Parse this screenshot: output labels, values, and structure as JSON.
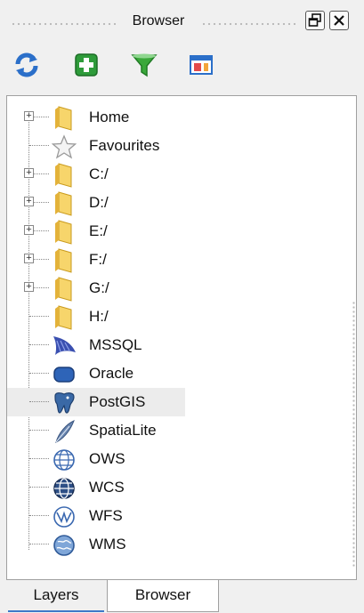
{
  "panel": {
    "title": "Browser"
  },
  "toolbar": {
    "buttons": [
      {
        "name": "refresh",
        "icon": "refresh-icon"
      },
      {
        "name": "add-layer",
        "icon": "add-icon"
      },
      {
        "name": "filter",
        "icon": "filter-icon"
      },
      {
        "name": "collapse-all",
        "icon": "collapse-all-icon"
      }
    ]
  },
  "tree": {
    "items": [
      {
        "label": "Home",
        "icon": "folder-icon",
        "expandable": true
      },
      {
        "label": "Favourites",
        "icon": "star-icon",
        "expandable": false
      },
      {
        "label": "C:/",
        "icon": "folder-icon",
        "expandable": true
      },
      {
        "label": "D:/",
        "icon": "folder-icon",
        "expandable": true
      },
      {
        "label": "E:/",
        "icon": "folder-icon",
        "expandable": true
      },
      {
        "label": "F:/",
        "icon": "folder-icon",
        "expandable": true
      },
      {
        "label": "G:/",
        "icon": "folder-icon",
        "expandable": true
      },
      {
        "label": "H:/",
        "icon": "folder-icon",
        "expandable": false
      },
      {
        "label": "MSSQL",
        "icon": "mssql-icon",
        "expandable": false
      },
      {
        "label": "Oracle",
        "icon": "oracle-icon",
        "expandable": false
      },
      {
        "label": "PostGIS",
        "icon": "postgis-icon",
        "expandable": false,
        "selected": true
      },
      {
        "label": "SpatiaLite",
        "icon": "spatialite-icon",
        "expandable": false
      },
      {
        "label": "OWS",
        "icon": "ows-globe-icon",
        "expandable": false
      },
      {
        "label": "WCS",
        "icon": "wcs-globe-icon",
        "expandable": false
      },
      {
        "label": "WFS",
        "icon": "wfs-globe-icon",
        "expandable": false
      },
      {
        "label": "WMS",
        "icon": "wms-globe-icon",
        "expandable": false
      }
    ]
  },
  "tabs": {
    "layers": "Layers",
    "browser": "Browser"
  },
  "colors": {
    "accent": "#3c78c8",
    "folder": "#f2c94c",
    "add_green": "#2e9b3a",
    "filter_green": "#3aa83a"
  }
}
